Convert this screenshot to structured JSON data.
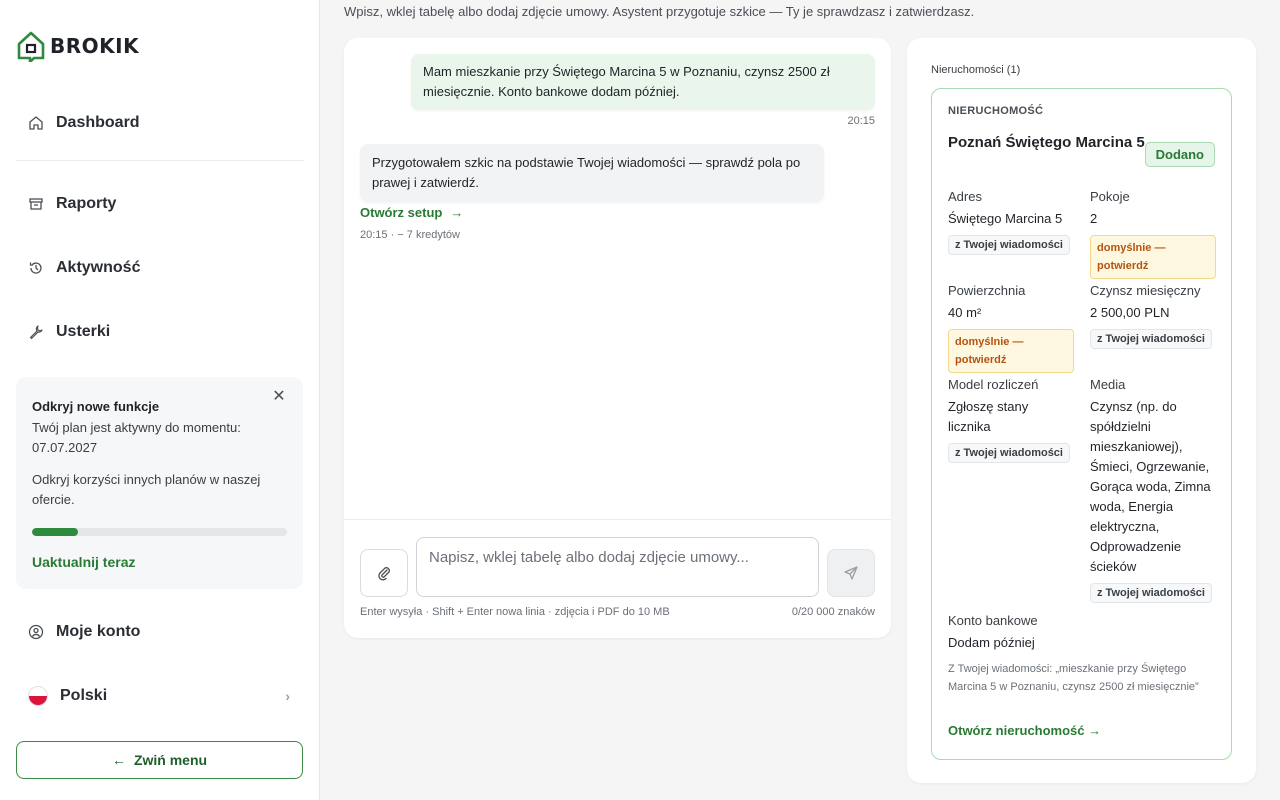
{
  "brand": {
    "name": "BROKIK",
    "accent": "#2a7a34"
  },
  "sidebar": {
    "nav": [
      {
        "label": "Dashboard",
        "icon": "home-icon"
      },
      {
        "label": "Raporty",
        "icon": "archive-icon"
      },
      {
        "label": "Aktywność",
        "icon": "history-icon"
      },
      {
        "label": "Usterki",
        "icon": "wrench-icon"
      }
    ],
    "promo": {
      "title": "Odkryj nowe funkcje",
      "text": "Twój plan jest aktywny do momentu: 07.07.2027",
      "text2": "Odkryj korzyści innych planów w naszej ofercie.",
      "progress_fraction": 0.18,
      "upgrade_label": "Uaktualnij teraz"
    },
    "account_label": "Moje konto",
    "language_label": "Polski",
    "collapse_label": "Zwiń menu"
  },
  "header": {
    "hint": "Wpisz, wklej tabelę albo dodaj zdjęcie umowy. Asystent przygotuje szkice — Ty je sprawdzasz i zatwierdzasz."
  },
  "chat": {
    "user_message": "Mam mieszkanie przy Świętego Marcina 5 w Poznaniu, czynsz 2500 zł miesięcznie. Konto bankowe dodam później.",
    "user_time": "20:15",
    "bot_message": "Przygotowałem szkic na podstawie Twojej wiadomości — sprawdź pola po prawej i zatwierdź.",
    "open_setup_label": "Otwórz setup",
    "bot_meta": "20:15 · − 7 kredytów",
    "composer": {
      "placeholder": "Napisz, wklej tabelę albo dodaj zdjęcie umowy...",
      "help": "Enter wysyła · Shift + Enter nowa linia · zdjęcia i PDF do 10 MB",
      "count": "0/20 000 znaków"
    }
  },
  "properties": {
    "heading": "Nieruchomości (1)",
    "card": {
      "label": "NIERUCHOMOŚĆ",
      "title": "Poznań Świętego Marcina 5",
      "status": "Dodano",
      "fields": {
        "address": {
          "name": "Adres",
          "value": "Świętego Marcina 5",
          "tag": "z Twojej wiadomości"
        },
        "rooms": {
          "name": "Pokoje",
          "value": "2",
          "tag": "domyślnie — potwierdź"
        },
        "area": {
          "name": "Powierzchnia",
          "value": "40 m²",
          "tag": "domyślnie — potwierdź"
        },
        "rent": {
          "name": "Czynsz miesięczny",
          "value": "2 500,00 PLN",
          "tag": "z Twojej wiadomości"
        },
        "billing": {
          "name": "Model rozliczeń",
          "value": "Zgłoszę stany licznika",
          "tag": "z Twojej wiadomości"
        },
        "media": {
          "name": "Media",
          "value": "Czynsz (np. do spółdzielni mieszkaniowej), Śmieci, Ogrzewanie, Gorąca woda, Zimna woda, Energia elektryczna, Odprowadzenie ścieków",
          "tag": "z Twojej wiadomości"
        },
        "bank": {
          "name": "Konto bankowe",
          "value": "Dodam później"
        }
      },
      "quote": "Z Twojej wiadomości: „mieszkanie przy Świętego Marcina 5 w Poznaniu, czynsz 2500 zł miesięcznie”",
      "open_label": "Otwórz nieruchomość →"
    }
  }
}
